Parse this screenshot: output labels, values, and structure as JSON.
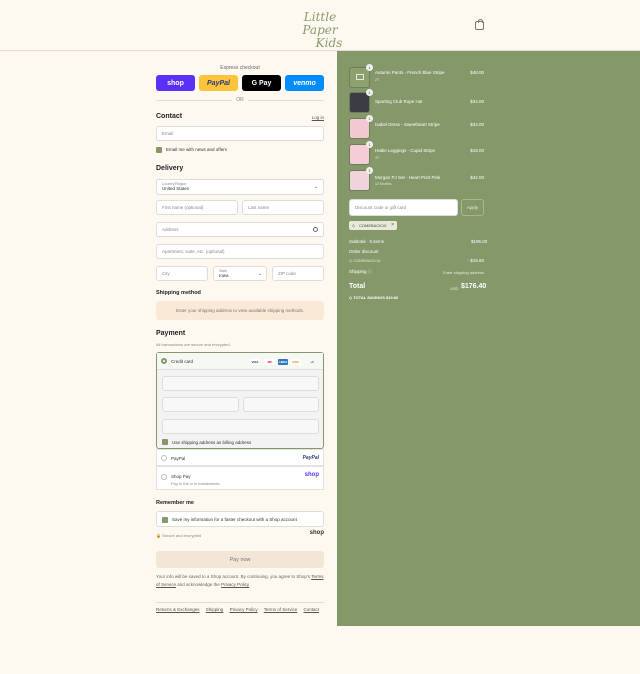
{
  "header": {
    "logo_line1": "Little Paper",
    "logo_line2": "Kids"
  },
  "express": {
    "title": "Express checkout",
    "shop": "shop",
    "paypal": "PayPal",
    "gpay": "G Pay",
    "venmo": "venmo",
    "or": "OR"
  },
  "contact": {
    "title": "Contact",
    "login": "Log in",
    "email_placeholder": "Email",
    "news_label": "Email me with news and offers"
  },
  "delivery": {
    "title": "Delivery",
    "country_label": "Country/Region",
    "country_value": "United States",
    "first_name": "First name (optional)",
    "last_name": "Last name",
    "address": "Address",
    "apartment": "Apartment, suite, etc. (optional)",
    "city": "City",
    "state_label": "State",
    "state_value": "Iowa",
    "zip": "ZIP code"
  },
  "shipping": {
    "title": "Shipping method",
    "info": "Enter your shipping address to view available shipping methods."
  },
  "payment": {
    "title": "Payment",
    "subtitle": "All transactions are secure and encrypted.",
    "credit_card": "Credit card",
    "brands": [
      "VISA",
      "MC",
      "AMEX",
      "DISC",
      "+5"
    ],
    "billing_label": "Use shipping address as billing address",
    "paypal": "PayPal",
    "paypal_logo": "PayPal",
    "shop_pay": "Shop Pay",
    "shop_pay_sub": "Pay in full or in installments",
    "shop_logo": "shop"
  },
  "remember": {
    "title": "Remember me",
    "label": "Save my information for a faster checkout with a Shop account",
    "secure": "Secure and encrypted",
    "shop_logo": "shop"
  },
  "pay_now": "Pay now",
  "legal": {
    "line1": "Your info will be saved to a Shop account. By continuing, you agree to Shop's",
    "terms": "Terms of Service",
    "and": "and acknowledge the",
    "privacy": "Privacy Policy"
  },
  "footer_links": [
    "Returns & Exchanges",
    "Shipping",
    "Privacy Policy",
    "Terms of Service",
    "Contact"
  ],
  "order": {
    "items": [
      {
        "name": "Autumn Pants - French Blue Stripe",
        "sub": "2T",
        "price": "$48.00",
        "qty": "1"
      },
      {
        "name": "Sporting Club Rope Hat",
        "sub": "",
        "price": "$34.00",
        "qty": "1"
      },
      {
        "name": "Isabel Dress - Sweetheart Stripe",
        "sub": "",
        "price": "$34.00",
        "qty": "1"
      },
      {
        "name": "Hattie Leggings - Cupid Stripe",
        "sub": "3T",
        "price": "$18.00",
        "qty": "1"
      },
      {
        "name": "Morgan PJ Set - Heart Print Pink",
        "sub": "12 Months",
        "price": "$42.00",
        "qty": "1"
      }
    ],
    "discount_placeholder": "Discount code or gift card",
    "apply": "Apply",
    "code_tag": "COMEBACK10",
    "subtotal_label": "Subtotal · 5 items",
    "subtotal": "$196.00",
    "order_discount_label": "Order discount",
    "discount_code": "COMEBACK10",
    "discount_value": "- $19.60",
    "shipping_label": "Shipping",
    "shipping_value": "Enter shipping address",
    "total_label": "Total",
    "currency": "USD",
    "total": "$176.40",
    "savings_label": "TOTAL SAVINGS",
    "savings": "$19.60"
  },
  "colors": {
    "sidebar": "#84986a",
    "accent": "#84986a",
    "shop": "#5a31f4",
    "paypal": "#ffc439",
    "venmo": "#008cff"
  }
}
